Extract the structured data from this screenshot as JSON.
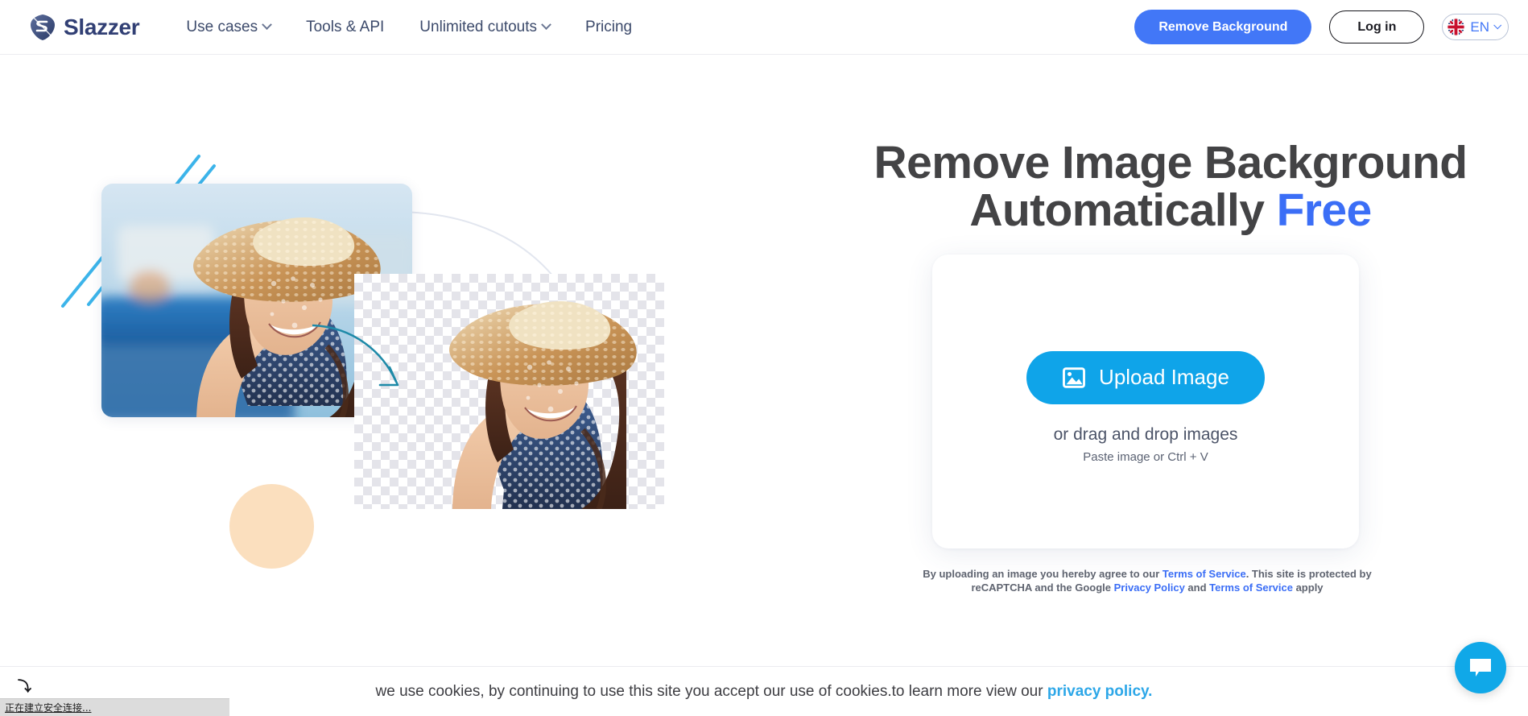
{
  "brand": {
    "name": "Slazzer",
    "logo_icon": "slazzer-logo-icon",
    "primary_blue": "#4277f7",
    "accent_cyan": "#0fa4e9",
    "heading_gray": "#434345"
  },
  "header": {
    "nav": [
      {
        "label": "Use cases",
        "has_dropdown": true
      },
      {
        "label": "Tools & API",
        "has_dropdown": false
      },
      {
        "label": "Unlimited cutouts",
        "has_dropdown": true
      },
      {
        "label": "Pricing",
        "has_dropdown": false
      }
    ],
    "remove_background_label": "Remove Background",
    "login_label": "Log in",
    "language": {
      "code": "EN",
      "flag_icon": "uk-flag-icon",
      "chevron_icon": "chevron-down-icon"
    }
  },
  "hero": {
    "headline_line1": "Remove Image Background",
    "headline_line2_main": "Automatically ",
    "headline_line2_accent": "Free",
    "before_image_alt": "woman in straw hat at harbour original photo",
    "after_image_alt": "woman in straw hat with transparent background",
    "decor": {
      "line_color": "#3cb4ea",
      "circle_color": "#fbdfbe",
      "arrow_color": "#1e8aa8",
      "ring_color": "#e2e6ef"
    }
  },
  "upload": {
    "button_label": "Upload Image",
    "button_icon": "image-icon",
    "drag_text": "or drag and drop images",
    "paste_text": "Paste image or Ctrl + V"
  },
  "legal": {
    "part1": "By uploading an image you hereby agree to our ",
    "tos1": "Terms of Service",
    "part2": ". This site is protected by reCAPTCHA and the Google ",
    "privacy": "Privacy Policy",
    "part3": " and ",
    "tos2": "Terms of Service",
    "part4": " apply"
  },
  "cookie": {
    "text": "we use cookies, by continuing to use this site you accept our use of cookies.to learn more view our ",
    "link_label": "privacy policy."
  },
  "chat": {
    "icon": "chat-bubble-icon"
  },
  "browser_status": {
    "text": "正在建立安全连接...",
    "cursor_icon": "cursor-arrow-icon"
  }
}
